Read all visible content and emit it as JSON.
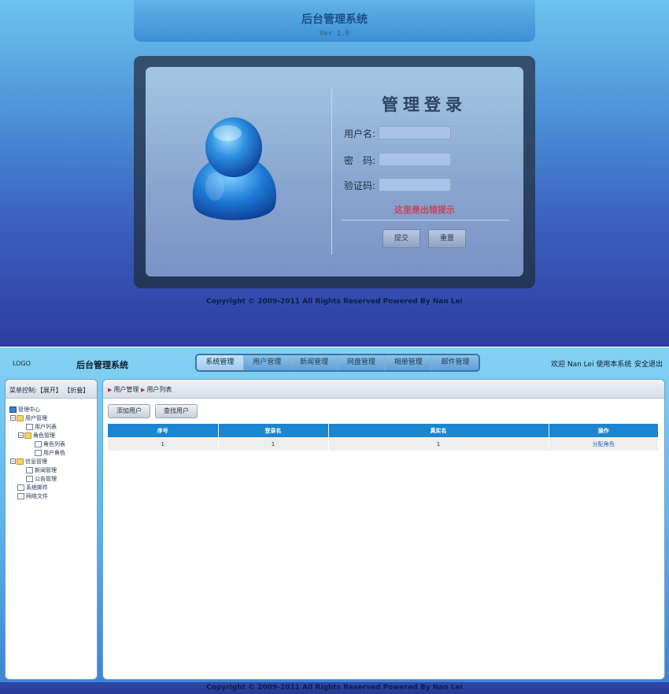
{
  "login": {
    "header_title": "后台管理系统",
    "header_version": "Ver 1.0",
    "panel_title": "管理登录",
    "username_label": "用户名:",
    "password_label": "密　码:",
    "captcha_label": "验证码:",
    "username_value": "",
    "password_value": "",
    "captcha_value": "",
    "error_tip": "这里是出错提示",
    "submit_label": "提交",
    "reset_label": "重置",
    "copyright": "Copyright © 2009-2011 All Rights Reserved Powered By Nan Lei"
  },
  "admin": {
    "logo": "LOGO",
    "system_name": "后台管理系统",
    "nav": [
      {
        "label": "系统管理",
        "active": true
      },
      {
        "label": "用户管理",
        "active": false
      },
      {
        "label": "新闻管理",
        "active": false
      },
      {
        "label": "网盘管理",
        "active": false
      },
      {
        "label": "相册管理",
        "active": false
      },
      {
        "label": "邮件管理",
        "active": false
      }
    ],
    "welcome": "欢迎 Nan Lei 使用本系统",
    "logout": "安全退出",
    "sidebar": {
      "head_prefix": "菜单控制:",
      "expand": "【展开】",
      "collapse": "【折叠】",
      "tree": [
        {
          "label": "管理中心",
          "icon": "computer-icon"
        },
        {
          "label": "用户管理",
          "icon": "folder-open-icon"
        },
        {
          "label": "用户列表",
          "icon": "page-icon"
        },
        {
          "label": "角色管理",
          "icon": "folder-open-icon"
        },
        {
          "label": "角色列表",
          "icon": "page-icon"
        },
        {
          "label": "用户角色",
          "icon": "page-icon"
        },
        {
          "label": "信息管理",
          "icon": "folder-open-icon"
        },
        {
          "label": "新闻管理",
          "icon": "page-icon"
        },
        {
          "label": "公告管理",
          "icon": "page-icon"
        },
        {
          "label": "系统邮件",
          "icon": "page-icon"
        },
        {
          "label": "网络文件",
          "icon": "page-icon"
        }
      ]
    },
    "breadcrumb": [
      "用户管理",
      "用户列表"
    ],
    "toolbar": {
      "add_label": "添加用户",
      "find_label": "查找用户"
    },
    "table": {
      "headers": [
        "序号",
        "登录名",
        "真实名",
        "操作"
      ],
      "rows": [
        {
          "index": "1",
          "login": "1",
          "real": "1",
          "action": "分配角色"
        }
      ]
    },
    "copyright": "Copyright © 2009-2011 All Rights Reserved Powered By Nan Lei"
  },
  "colors": {
    "accent": "#1b85cf",
    "error": "#c84659",
    "login_bg_top": "#6cc4ee",
    "login_bg_bottom": "#2f3d9e"
  }
}
